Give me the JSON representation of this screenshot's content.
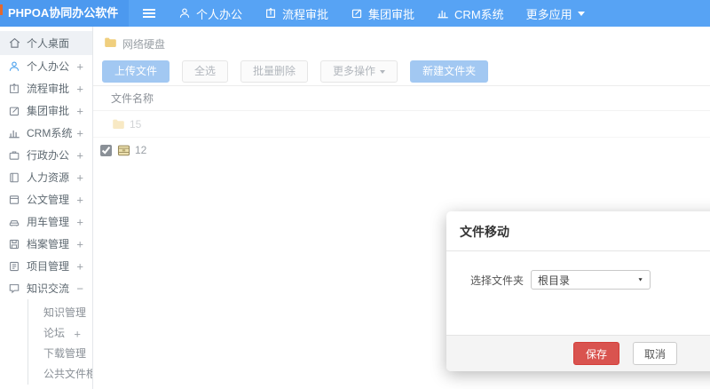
{
  "colors": {
    "header_blue": "#57a3f4",
    "logo_blue": "#4c99ef",
    "primary_button_blue": "#a2c8f2",
    "save_red": "#d9534f",
    "folder_yellow": "#f0cf7e"
  },
  "header": {
    "logo": "PHPOA协同办公软件",
    "nav": [
      {
        "label": "个人办公",
        "icon": "person-icon"
      },
      {
        "label": "流程审批",
        "icon": "share-icon"
      },
      {
        "label": "集团审批",
        "icon": "edit-icon"
      },
      {
        "label": "CRM系统",
        "icon": "chart-icon"
      },
      {
        "label": "更多应用",
        "icon": "caret-down-icon"
      }
    ]
  },
  "sidebar": {
    "items": [
      {
        "label": "个人桌面",
        "expand": ""
      },
      {
        "label": "个人办公",
        "expand": "+"
      },
      {
        "label": "流程审批",
        "expand": "+"
      },
      {
        "label": "集团审批",
        "expand": "+"
      },
      {
        "label": "CRM系统",
        "expand": "+"
      },
      {
        "label": "行政办公",
        "expand": "+"
      },
      {
        "label": "人力资源",
        "expand": "+"
      },
      {
        "label": "公文管理",
        "expand": "+"
      },
      {
        "label": "用车管理",
        "expand": "+"
      },
      {
        "label": "档案管理",
        "expand": "+"
      },
      {
        "label": "项目管理",
        "expand": "+"
      },
      {
        "label": "知识交流",
        "expand": "−"
      }
    ],
    "submenu": [
      {
        "label": "知识管理",
        "expand": ""
      },
      {
        "label": "论坛",
        "expand": "+"
      },
      {
        "label": "下载管理",
        "expand": ""
      },
      {
        "label": "公共文件柜",
        "expand": ""
      }
    ]
  },
  "main": {
    "breadcrumb": "网络硬盘",
    "toolbar": {
      "upload": "上传文件",
      "select_all": "全选",
      "batch_delete": "批量删除",
      "more_actions": "更多操作",
      "new_folder": "新建文件夹"
    },
    "table": {
      "name_header": "文件名称",
      "rows": [
        {
          "name": "15",
          "icon": "folder-icon",
          "checked": false
        },
        {
          "name": "12",
          "icon": "archive-icon",
          "checked": true
        }
      ]
    }
  },
  "modal": {
    "title": "文件移动",
    "field_label": "选择文件夹",
    "selected_folder": "根目录",
    "save_label": "保存",
    "cancel_label": "取消"
  }
}
